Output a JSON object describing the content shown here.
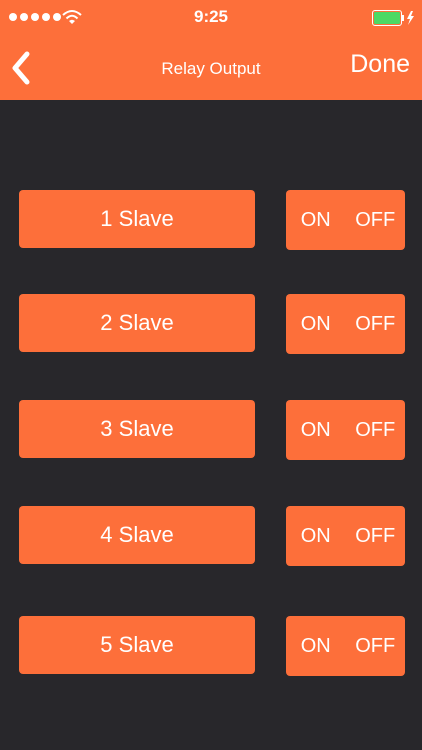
{
  "status_bar": {
    "time": "9:25",
    "signal_icon": "signal-dots-icon",
    "wifi_icon": "wifi-icon",
    "battery_icon": "battery-charging-icon",
    "battery_color": "#4cd964"
  },
  "nav": {
    "back_icon": "chevron-left-icon",
    "title": "Relay Output",
    "done_label": "Done"
  },
  "colors": {
    "accent": "#fd6f3a",
    "background": "#28272b"
  },
  "relays": [
    {
      "label": "1 Slave",
      "on_label": "ON",
      "off_label": "OFF"
    },
    {
      "label": "2 Slave",
      "on_label": "ON",
      "off_label": "OFF"
    },
    {
      "label": "3 Slave",
      "on_label": "ON",
      "off_label": "OFF"
    },
    {
      "label": "4 Slave",
      "on_label": "ON",
      "off_label": "OFF"
    },
    {
      "label": "5 Slave",
      "on_label": "ON",
      "off_label": "OFF"
    }
  ]
}
